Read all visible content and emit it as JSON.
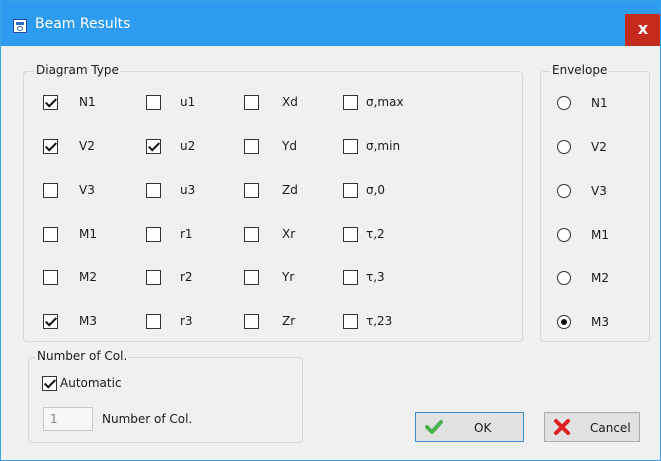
{
  "window": {
    "title": "Beam Results",
    "close_glyph": "x"
  },
  "diagram_type": {
    "legend": "Diagram Type",
    "columns": [
      [
        {
          "label": "N1",
          "checked": true
        },
        {
          "label": "V2",
          "checked": true
        },
        {
          "label": "V3",
          "checked": false
        },
        {
          "label": "M1",
          "checked": false
        },
        {
          "label": "M2",
          "checked": false
        },
        {
          "label": "M3",
          "checked": true
        }
      ],
      [
        {
          "label": "u1",
          "checked": false
        },
        {
          "label": "u2",
          "checked": true
        },
        {
          "label": "u3",
          "checked": false
        },
        {
          "label": "r1",
          "checked": false
        },
        {
          "label": "r2",
          "checked": false
        },
        {
          "label": "r3",
          "checked": false
        }
      ],
      [
        {
          "label": "Xd",
          "checked": false
        },
        {
          "label": "Yd",
          "checked": false
        },
        {
          "label": "Zd",
          "checked": false
        },
        {
          "label": "Xr",
          "checked": false
        },
        {
          "label": "Yr",
          "checked": false
        },
        {
          "label": "Zr",
          "checked": false
        }
      ],
      [
        {
          "label": "σ,max",
          "checked": false
        },
        {
          "label": "σ,min",
          "checked": false
        },
        {
          "label": "σ,0",
          "checked": false
        },
        {
          "label": "τ,2",
          "checked": false
        },
        {
          "label": "τ,3",
          "checked": false
        },
        {
          "label": "τ,23",
          "checked": false
        }
      ]
    ]
  },
  "envelope": {
    "legend": "Envelope",
    "options": [
      "N1",
      "V2",
      "V3",
      "M1",
      "M2",
      "M3"
    ],
    "selected": "M3"
  },
  "number_of_col": {
    "legend": "Number of Col.",
    "automatic_label": "Automatic",
    "automatic_checked": true,
    "value": "1",
    "field_label": "Number of Col."
  },
  "buttons": {
    "ok": "OK",
    "cancel": "Cancel"
  },
  "colors": {
    "titlebar": "#2d9cf0",
    "close": "#c42b1c",
    "ok_icon": "#4caf50",
    "cancel_icon": "#e02020"
  },
  "icons": {
    "title": "beam-results-app-icon",
    "ok": "green-check-icon",
    "cancel": "red-x-icon"
  }
}
